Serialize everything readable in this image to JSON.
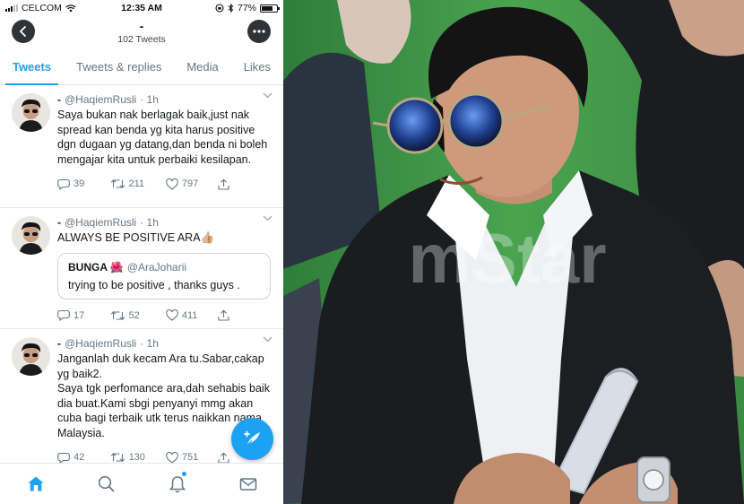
{
  "status_bar": {
    "carrier": "CELCOM",
    "time": "12:35 AM",
    "battery": "77%",
    "battery_level": 0.77
  },
  "profile_header": {
    "name": "-",
    "tweet_count": "102 Tweets"
  },
  "tabs": [
    {
      "label": "Tweets",
      "active": true
    },
    {
      "label": "Tweets & replies",
      "active": false
    },
    {
      "label": "Media",
      "active": false
    },
    {
      "label": "Likes",
      "active": false
    }
  ],
  "tweets": [
    {
      "name": "-",
      "handle": "@HaqiemRusli",
      "time": "· 1h",
      "text": "Saya bukan nak berlagak baik,just nak spread kan benda yg kita harus positive dgn dugaan yg datang,dan benda ni boleh mengajar kita untuk perbaiki kesilapan.",
      "replies": "39",
      "retweets": "211",
      "likes": "797"
    },
    {
      "name": "-",
      "handle": "@HaqiemRusli",
      "time": "· 1h",
      "text": "ALWAYS BE POSITIVE ARA👍🏼",
      "quote": {
        "name": "BUNGA 🌺",
        "handle": "@AraJoharii",
        "text": "trying to be positive , thanks guys ."
      },
      "replies": "17",
      "retweets": "52",
      "likes": "411"
    },
    {
      "name": "-",
      "handle": "@HaqiemRusli",
      "time": "· 1h",
      "text": "Janganlah duk kecam Ara tu.Sabar,cakap yg baik2.\nSaya tgk perfomance ara,dah sehabis baik dia buat.Kami sbgi penyanyi mmg akan cuba bagi terbaik utk terus naikkan nama Malaysia.",
      "replies": "42",
      "retweets": "130",
      "likes": "751"
    }
  ],
  "bottom_nav": [
    "home-icon",
    "search-icon",
    "notifications-icon",
    "messages-icon"
  ],
  "photo": {
    "watermark": "mStar"
  },
  "colors": {
    "accent": "#1da1f2",
    "text": "#14171a",
    "muted": "#657786",
    "header_button": "#2f3336"
  }
}
